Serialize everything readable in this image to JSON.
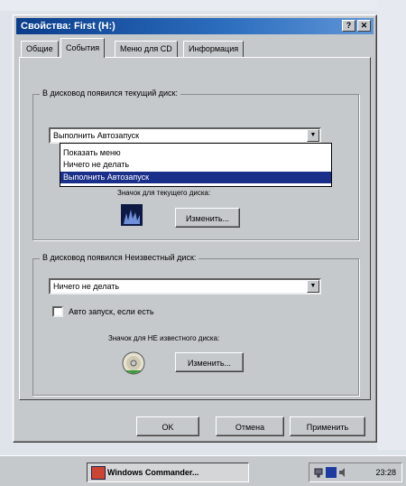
{
  "window": {
    "title": "Свойства: First (H:)",
    "help_glyph": "?",
    "close_glyph": "✕"
  },
  "tabs": [
    {
      "label": "Общие"
    },
    {
      "label": "События"
    },
    {
      "label": "Меню для CD"
    },
    {
      "label": "Информация"
    }
  ],
  "known_disc": {
    "group_label": "В дисковод появился текущий диск:",
    "combo_value": "Выполнить Автозапуск",
    "dropdown_options": [
      "Показать меню",
      "Ничего не делать",
      "Выполнить Автозапуск"
    ],
    "selected_option_index": 2,
    "icon_caption": "Значок для текущего диска:",
    "change_button": "Изменить..."
  },
  "unknown_disc": {
    "group_label": "В дисковод появился Неизвестный диск:",
    "combo_value": "Ничего не делать",
    "autorun_checkbox": "Авто запуск, если есть",
    "icon_caption": "Значок для НЕ известного диска:",
    "change_button": "Изменить..."
  },
  "dialog_buttons": {
    "ok": "OK",
    "cancel": "Отмена",
    "apply": "Применить"
  },
  "taskbar": {
    "task_label": "Windows Commander...",
    "clock": "23:28"
  },
  "colors": {
    "title_start": "#0a3d8c",
    "selection": "#1a2f8a",
    "face": "#c6c9cc"
  }
}
